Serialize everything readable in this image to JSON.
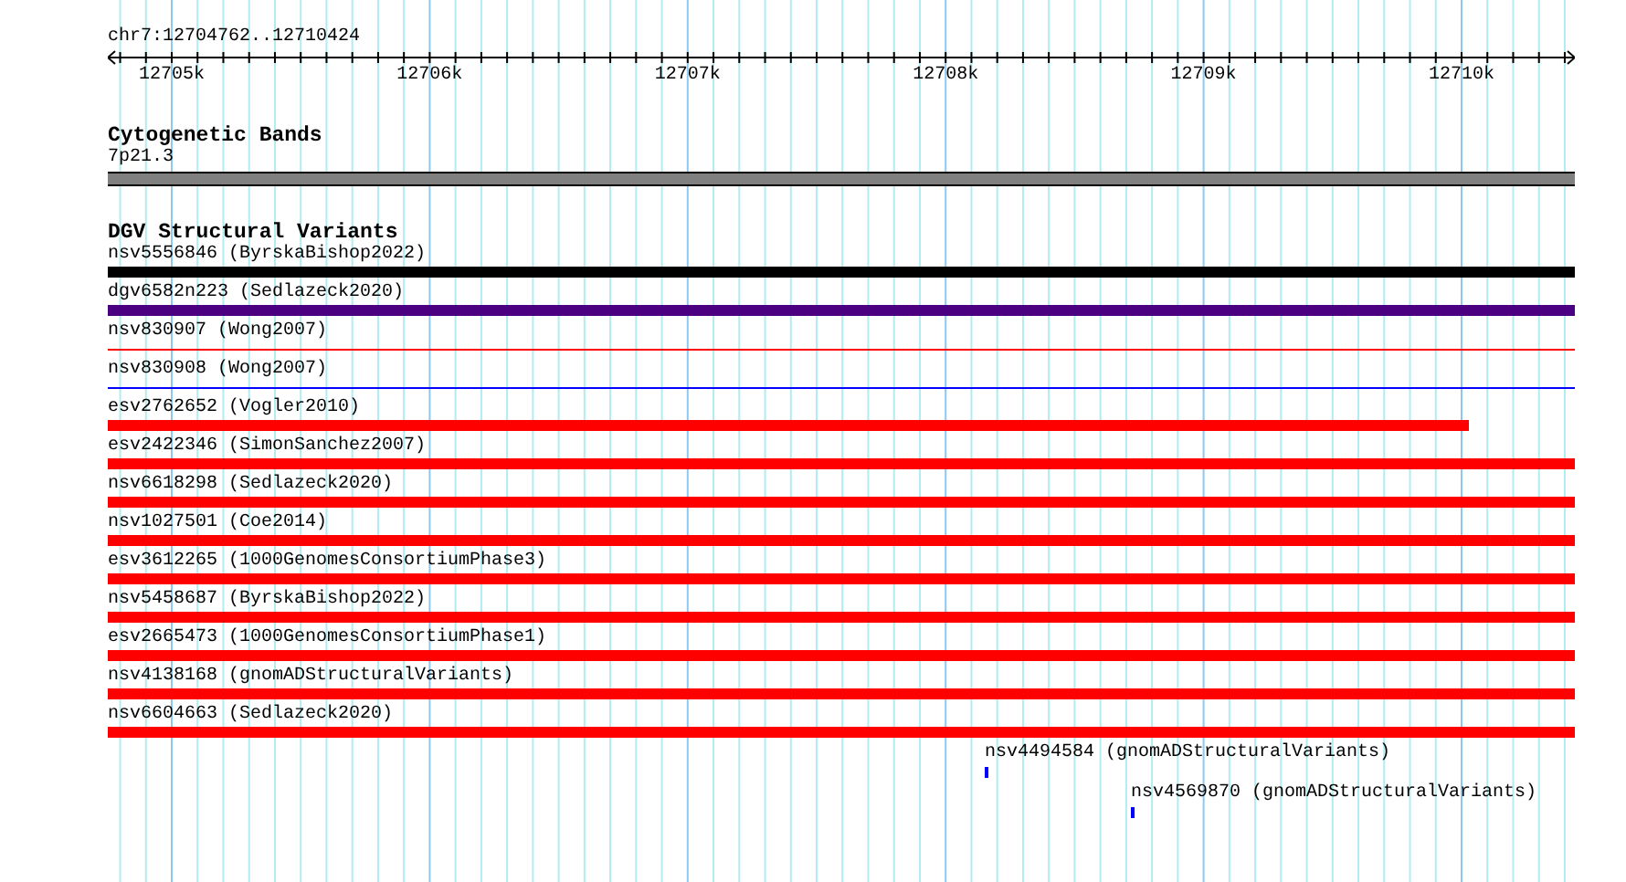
{
  "ruler": {
    "location": "chr7:12704762..12710424",
    "ticks": [
      "12705k",
      "12706k",
      "12707k",
      "12708k",
      "12709k",
      "12710k"
    ]
  },
  "tracks": [
    {
      "title": "Cytogenetic Bands",
      "features": [
        {
          "label": "7p21.3",
          "kind": "band",
          "color": "#808080"
        }
      ]
    },
    {
      "title": "DGV Structural Variants",
      "features": [
        {
          "label": "nsv5556846 (ByrskaBishop2022)",
          "kind": "thick",
          "color": "#000000",
          "ends_early": false
        },
        {
          "label": "dgv6582n223 (Sedlazeck2020)",
          "kind": "thick",
          "color": "#4b0082",
          "ends_early": false
        },
        {
          "label": "nsv830907 (Wong2007)",
          "kind": "thin",
          "color": "#ff0000",
          "ends_early": false
        },
        {
          "label": "nsv830908 (Wong2007)",
          "kind": "thin",
          "color": "#0000ff",
          "ends_early": false
        },
        {
          "label": "esv2762652 (Vogler2010)",
          "kind": "thick",
          "color": "#ff0000",
          "ends_early": true
        },
        {
          "label": "esv2422346 (SimonSanchez2007)",
          "kind": "thick",
          "color": "#ff0000",
          "ends_early": false
        },
        {
          "label": "nsv6618298 (Sedlazeck2020)",
          "kind": "thick",
          "color": "#ff0000",
          "ends_early": false
        },
        {
          "label": "nsv1027501 (Coe2014)",
          "kind": "thick",
          "color": "#ff0000",
          "ends_early": false
        },
        {
          "label": "esv3612265 (1000GenomesConsortiumPhase3)",
          "kind": "thick",
          "color": "#ff0000",
          "ends_early": false
        },
        {
          "label": "nsv5458687 (ByrskaBishop2022)",
          "kind": "thick",
          "color": "#ff0000",
          "ends_early": false
        },
        {
          "label": "esv2665473 (1000GenomesConsortiumPhase1)",
          "kind": "thick",
          "color": "#ff0000",
          "ends_early": false
        },
        {
          "label": "nsv4138168 (gnomADStructuralVariants)",
          "kind": "thick",
          "color": "#ff0000",
          "ends_early": false
        },
        {
          "label": "nsv6604663 (Sedlazeck2020)",
          "kind": "thick",
          "color": "#ff0000",
          "ends_early": false
        },
        {
          "label": "nsv4494584 (gnomADStructuralVariants)",
          "kind": "point",
          "color": "#0000ff"
        },
        {
          "label": "nsv4569870 (gnomADStructuralVariants)",
          "kind": "point",
          "color": "#0000ff"
        }
      ]
    }
  ]
}
